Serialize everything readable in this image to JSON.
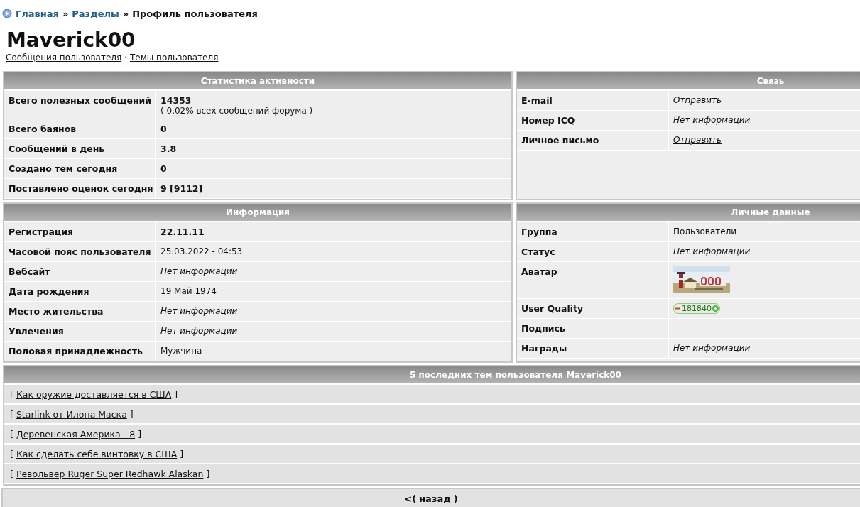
{
  "breadcrumb": {
    "links": [
      "Главная",
      "Разделы"
    ],
    "separators": [
      "»",
      "»"
    ],
    "current": "Профиль пользователя"
  },
  "profile": {
    "name": "Maverick00",
    "links": [
      "Сообщения пользователя",
      "Темы пользователя"
    ],
    "link_separator": "·"
  },
  "panels": [
    {
      "title": "Статистика активности",
      "rows": [
        {
          "label": "Всего полезных сообщений",
          "kind": "bold",
          "value": "14353",
          "note": "( 0.02% всех сообщений форума )"
        },
        {
          "label": "Всего баянов",
          "kind": "bold",
          "value": "0"
        },
        {
          "label": "Сообщений в день",
          "kind": "bold",
          "value": "3.8"
        },
        {
          "label": "Создано тем сегодня",
          "kind": "bold",
          "value": "0"
        },
        {
          "label": "Поставлено оценок сегодня",
          "kind": "bold",
          "value": "9 [9112]"
        }
      ]
    },
    {
      "title": "Связь",
      "rows": [
        {
          "label": "E-mail",
          "kind": "link",
          "value": "Отправить"
        },
        {
          "label": "Номер ICQ",
          "kind": "italic",
          "value": "Нет информации"
        },
        {
          "label": "Личное письмо",
          "kind": "link",
          "value": "Отправить"
        }
      ]
    },
    {
      "title": "Информация",
      "rows": [
        {
          "label": "Регистрация",
          "kind": "bold",
          "value": "22.11.11"
        },
        {
          "label": "Часовой пояс пользователя",
          "kind": "plain",
          "value": "25.03.2022 - 04:53"
        },
        {
          "label": "Вебсайт",
          "kind": "italic",
          "value": "Нет информации"
        },
        {
          "label": "Дата рождения",
          "kind": "plain",
          "value": "19 Май 1974"
        },
        {
          "label": "Место жительства",
          "kind": "italic",
          "value": "Нет информации"
        },
        {
          "label": "Увлечения",
          "kind": "italic",
          "value": "Нет информации"
        },
        {
          "label": "Половая принадлежность",
          "kind": "plain",
          "value": "Мужчина"
        }
      ]
    },
    {
      "title": "Личные данные",
      "rows": [
        {
          "label": "Группа",
          "kind": "plain",
          "value": "Пользователи"
        },
        {
          "label": "Статус",
          "kind": "italic",
          "value": "Нет информации"
        },
        {
          "label": "Аватар",
          "kind": "picture"
        },
        {
          "label": "User Quality",
          "kind": "rating",
          "value": "181840"
        },
        {
          "label": "Подпись",
          "kind": "empty"
        },
        {
          "label": "Награды",
          "kind": "italic",
          "value": "Нет информации"
        }
      ]
    }
  ],
  "topics": {
    "title": "5 последних тем пользователя Maverick00",
    "items": [
      {
        "open": "[",
        "title": "Как оружие доставляется в США",
        "close": "]"
      },
      {
        "open": "[",
        "title": "Starlink от Илона Маска",
        "close": "]"
      },
      {
        "open": "[",
        "title": "Деревенская Америка - 8",
        "close": "]"
      },
      {
        "open": "[",
        "title": "Как сделать себе винтовку в США",
        "close": "]"
      },
      {
        "open": "[",
        "title": "Револьвер Ruger Super Redhawk Alaskan",
        "close": "]"
      }
    ]
  },
  "back": {
    "open": "<(",
    "link": "назад",
    "close": ")"
  }
}
